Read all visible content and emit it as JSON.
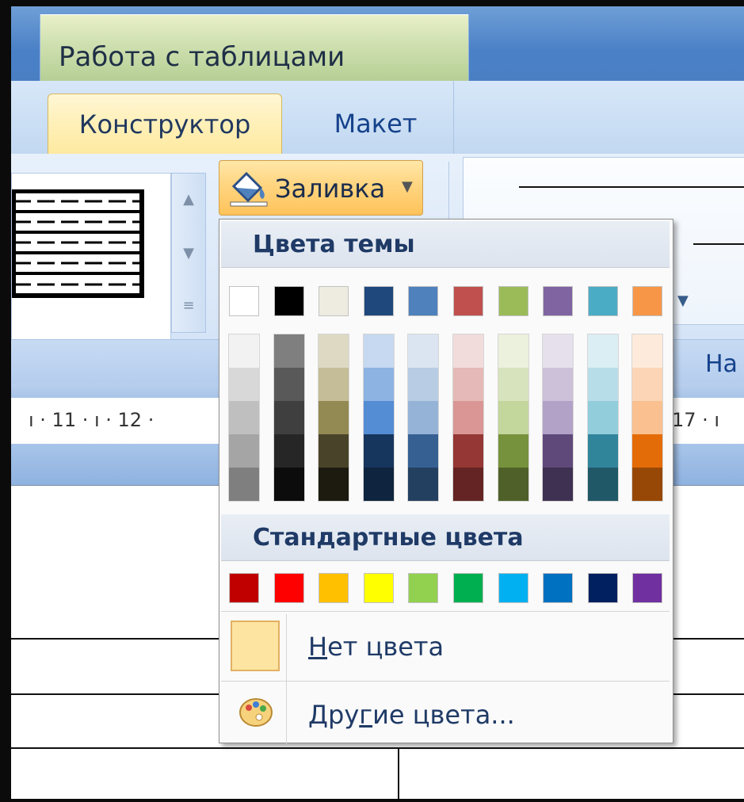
{
  "context_bar": {
    "title": "Работа с таблицами"
  },
  "tabs": [
    {
      "label": "Конструктор",
      "active": true
    },
    {
      "label": "Макет",
      "active": false
    }
  ],
  "ribbon": {
    "fill_button": {
      "label": "Заливка",
      "icon": "paint-bucket-icon"
    },
    "group_label_partial": "На",
    "ruler_left": "ı · 11 · ı · 12 ·",
    "ruler_right": "17 · ı"
  },
  "color_menu": {
    "theme_heading": "Цвета темы",
    "standard_heading": "Стандартные цвета",
    "theme_colors": [
      "#FFFFFF",
      "#000000",
      "#EEECE1",
      "#1F497D",
      "#4F81BD",
      "#C0504D",
      "#9BBB59",
      "#8064A2",
      "#4BACC6",
      "#F79646"
    ],
    "theme_shades": [
      [
        "#F2F2F2",
        "#D8D8D8",
        "#BFBFBF",
        "#A5A5A5",
        "#7F7F7F"
      ],
      [
        "#7F7F7F",
        "#595959",
        "#3F3F3F",
        "#262626",
        "#0C0C0C"
      ],
      [
        "#DDD9C3",
        "#C4BD97",
        "#938953",
        "#494429",
        "#1D1B10"
      ],
      [
        "#C6D9F0",
        "#8DB3E2",
        "#548DD4",
        "#17365D",
        "#0F243E"
      ],
      [
        "#DBE5F1",
        "#B8CCE4",
        "#95B3D7",
        "#366092",
        "#244061"
      ],
      [
        "#F2DCDB",
        "#E5B9B7",
        "#D99694",
        "#953734",
        "#632423"
      ],
      [
        "#EBF1DD",
        "#D7E3BC",
        "#C3D69B",
        "#76923C",
        "#4F6128"
      ],
      [
        "#E5E0EC",
        "#CCC1D9",
        "#B2A2C7",
        "#5F497A",
        "#3F3151"
      ],
      [
        "#DBEEF3",
        "#B7DDE8",
        "#92CDDC",
        "#31859B",
        "#205867"
      ],
      [
        "#FDEADA",
        "#FBD5B5",
        "#FAC08F",
        "#E36C09",
        "#974806"
      ]
    ],
    "standard_colors": [
      "#C00000",
      "#FF0000",
      "#FFC000",
      "#FFFF00",
      "#92D050",
      "#00B050",
      "#00B0F0",
      "#0070C0",
      "#002060",
      "#7030A0"
    ],
    "no_color": {
      "hotkey": "Н",
      "rest": "ет цвета",
      "swatch": "#FFE8A6"
    },
    "more_colors": {
      "before": "Дру",
      "hotkey": "г",
      "after": "ие цвета...",
      "icon": "palette-icon"
    }
  }
}
